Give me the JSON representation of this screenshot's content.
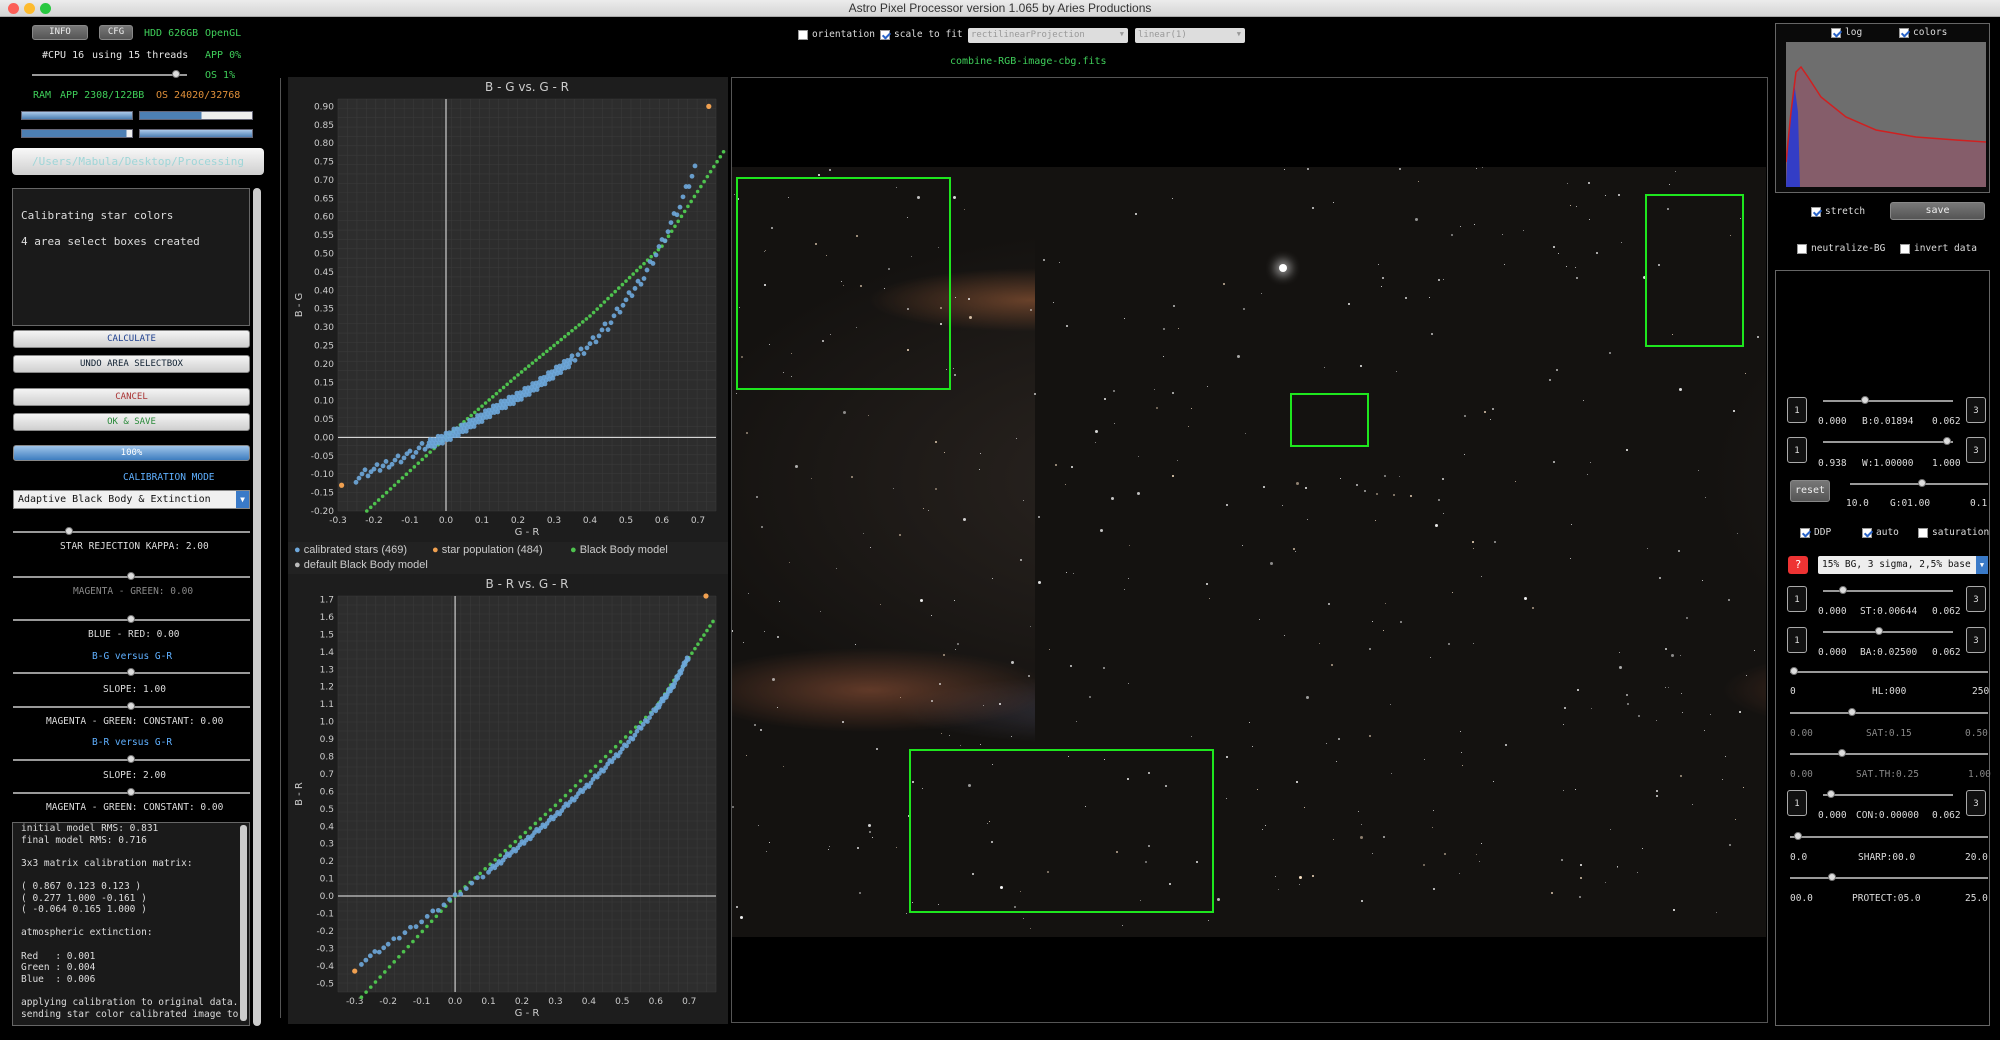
{
  "window": {
    "title": "Astro Pixel Processor version 1.065 by Aries Productions"
  },
  "top": {
    "info_btn": "INFO",
    "cfg_btn": "CFG",
    "hdd": "HDD 626GB",
    "opengl": "OpenGL",
    "cpu": "#CPU 16",
    "threads": "using 15 threads",
    "app_pct": "APP 0%",
    "os_pct": "OS 1%",
    "ram": "RAM",
    "app_mem": "APP 2308/122BB",
    "os_mem": "OS 24020/32768",
    "path": "/Users/Mabula/Desktop/Processing"
  },
  "toolbar": {
    "orientation": "orientation",
    "scale_to_fit": "scale to fit",
    "projection": "rectilinearProjection",
    "stretch_func": "linear(1)",
    "filename": "combine-RGB-image-cbg.fits"
  },
  "left": {
    "status_lines": [
      "Calibrating star colors",
      "4 area select boxes created"
    ],
    "calculate": "CALCULATE",
    "undo": "UNDO AREA SELECTBOX",
    "cancel": "CANCEL",
    "ok_save": "OK & SAVE",
    "progress": "100%",
    "progress_value": 1.0,
    "calib_mode_label": "CALIBRATION MODE",
    "calib_mode_value": "Adaptive Black Body & Extinction",
    "star_rejection": "STAR REJECTION KAPPA: 2.00",
    "magenta_green": "MAGENTA - GREEN: 0.00",
    "blue_red": "BLUE - RED: 0.00",
    "bg_vs_gr": "B-G versus G-R",
    "slope1": "SLOPE: 1.00",
    "mg_const1": "MAGENTA - GREEN: CONSTANT: 0.00",
    "br_vs_gr": "B-R versus G-R",
    "slope2": "SLOPE: 2.00",
    "mg_const2": "MAGENTA - GREEN: CONSTANT: 0.00",
    "log_lines": [
      "initial model RMS: 0.831",
      "final model RMS: 0.716",
      "",
      "3x3 matrix calibration matrix:",
      "",
      "( 0.867 0.123 0.123 )",
      "( 0.277 1.000 -0.161 )",
      "( -0.064 0.165 1.000 )",
      "",
      "atmospheric extinction:",
      "",
      "Red   : 0.001",
      "Green : 0.004",
      "Blue  : 0.006",
      "",
      "applying calibration to original data..",
      "sending star color calibrated image to"
    ]
  },
  "legend": {
    "calibrated": "calibrated stars (469)",
    "population": "star population (484)",
    "blackbody": "Black Body model",
    "default_bb": "default Black Body model"
  },
  "colors": {
    "calibrated": "#6ea8dc",
    "population": "#f0a050",
    "blackbody": "#4ec24e",
    "default_bb": "#bbbbbb",
    "selection_box": "#1ee61e"
  },
  "chart_data": [
    {
      "type": "scatter",
      "title": "B - G  vs.  G - R",
      "xlabel": "G - R",
      "ylabel": "B - G",
      "xlim": [
        -0.3,
        0.75
      ],
      "ylim": [
        -0.2,
        0.92
      ],
      "xticks": [
        "-0.3",
        "-0.2",
        "-0.1",
        "0.0",
        "0.1",
        "0.2",
        "0.3",
        "0.4",
        "0.5",
        "0.6",
        "0.7"
      ],
      "yticks": [
        "-0.20",
        "-0.15",
        "-0.10",
        "-0.05",
        "0.00",
        "0.05",
        "0.10",
        "0.15",
        "0.20",
        "0.25",
        "0.30",
        "0.35",
        "0.40",
        "0.45",
        "0.50",
        "0.55",
        "0.60",
        "0.65",
        "0.70",
        "0.75",
        "0.80",
        "0.85",
        "0.90"
      ],
      "series": [
        {
          "name": "calibrated stars (469)",
          "points": [
            [
              -0.25,
              -0.11
            ],
            [
              -0.2,
              -0.09
            ],
            [
              -0.15,
              -0.065
            ],
            [
              -0.1,
              -0.045
            ],
            [
              -0.05,
              -0.02
            ],
            [
              0.0,
              0.0
            ],
            [
              0.05,
              0.025
            ],
            [
              0.1,
              0.055
            ],
            [
              0.15,
              0.085
            ],
            [
              0.2,
              0.11
            ],
            [
              0.25,
              0.14
            ],
            [
              0.3,
              0.175
            ],
            [
              0.35,
              0.21
            ],
            [
              0.4,
              0.255
            ],
            [
              0.45,
              0.305
            ],
            [
              0.5,
              0.37
            ],
            [
              0.55,
              0.44
            ],
            [
              0.6,
              0.53
            ],
            [
              0.65,
              0.63
            ],
            [
              0.7,
              0.75
            ]
          ]
        },
        {
          "name": "star population (484)",
          "points": [
            [
              -0.29,
              -0.13
            ],
            [
              0.73,
              0.9
            ]
          ]
        },
        {
          "name": "Black Body model",
          "line": [
            [
              -0.22,
              -0.2
            ],
            [
              0.0,
              0.0
            ],
            [
              0.2,
              0.17
            ],
            [
              0.4,
              0.33
            ],
            [
              0.6,
              0.52
            ],
            [
              0.78,
              0.79
            ]
          ]
        }
      ]
    },
    {
      "type": "scatter",
      "title": "B - R  vs.  G - R",
      "xlabel": "G - R",
      "ylabel": "B - R",
      "xlim": [
        -0.35,
        0.78
      ],
      "ylim": [
        -0.55,
        1.72
      ],
      "xticks": [
        "-0.3",
        "-0.2",
        "-0.1",
        "0.0",
        "0.1",
        "0.2",
        "0.3",
        "0.4",
        "0.5",
        "0.6",
        "0.7"
      ],
      "yticks": [
        "-0.5",
        "-0.4",
        "-0.3",
        "-0.2",
        "-0.1",
        "0.0",
        "0.1",
        "0.2",
        "0.3",
        "0.4",
        "0.5",
        "0.6",
        "0.7",
        "0.8",
        "0.9",
        "1.0",
        "1.1",
        "1.2",
        "1.3",
        "1.4",
        "1.5",
        "1.6",
        "1.7"
      ],
      "series": [
        {
          "name": "calibrated stars (469)",
          "points": [
            [
              -0.28,
              -0.38
            ],
            [
              -0.2,
              -0.28
            ],
            [
              -0.1,
              -0.14
            ],
            [
              0.0,
              0.0
            ],
            [
              0.1,
              0.14
            ],
            [
              0.2,
              0.3
            ],
            [
              0.3,
              0.46
            ],
            [
              0.4,
              0.64
            ],
            [
              0.5,
              0.84
            ],
            [
              0.6,
              1.07
            ],
            [
              0.65,
              1.2
            ],
            [
              0.7,
              1.38
            ]
          ]
        },
        {
          "name": "star population (484)",
          "points": [
            [
              -0.3,
              -0.43
            ],
            [
              0.75,
              1.72
            ]
          ]
        },
        {
          "name": "Black Body model",
          "line": [
            [
              -0.28,
              -0.58
            ],
            [
              0.0,
              0.0
            ],
            [
              0.3,
              0.52
            ],
            [
              0.6,
              1.08
            ],
            [
              0.78,
              1.6
            ]
          ]
        }
      ]
    }
  ],
  "right": {
    "log": "log",
    "colors": "colors",
    "stretch": "stretch",
    "save": "save",
    "neutralize": "neutralize-BG",
    "invert": "invert data",
    "b_min": "0.000",
    "b_val": "B:0.01894",
    "b_max": "0.062",
    "w_min": "0.938",
    "w_val": "W:1.00000",
    "w_max": "1.000",
    "reset": "reset",
    "g_min": "10.0",
    "g_val": "G:01.00",
    "g_max": "0.1",
    "ddp": "DDP",
    "auto": "auto",
    "saturation": "saturation",
    "preset": "15% BG, 3 sigma, 2,5% base",
    "st_min": "0.000",
    "st_val": "ST:0.00644",
    "st_max": "0.062",
    "ba_min": "0.000",
    "ba_val": "BA:0.02500",
    "ba_max": "0.062",
    "hl_min": "0",
    "hl_val": "HL:000",
    "hl_max": "250",
    "sat_min": "0.00",
    "sat_val": "SAT:0.15",
    "sat_max": "0.50",
    "satth_min": "0.00",
    "satth_val": "SAT.TH:0.25",
    "satth_max": "1.00",
    "con_min": "0.000",
    "con_val": "CON:0.00000",
    "con_max": "0.062",
    "sharp_min": "0.0",
    "sharp_val": "SHARP:00.0",
    "sharp_max": "20.0",
    "protect_min": "00.0",
    "protect_val": "PROTECT:05.0",
    "protect_max": "25.0",
    "step_left": "1",
    "step_right": "3"
  }
}
